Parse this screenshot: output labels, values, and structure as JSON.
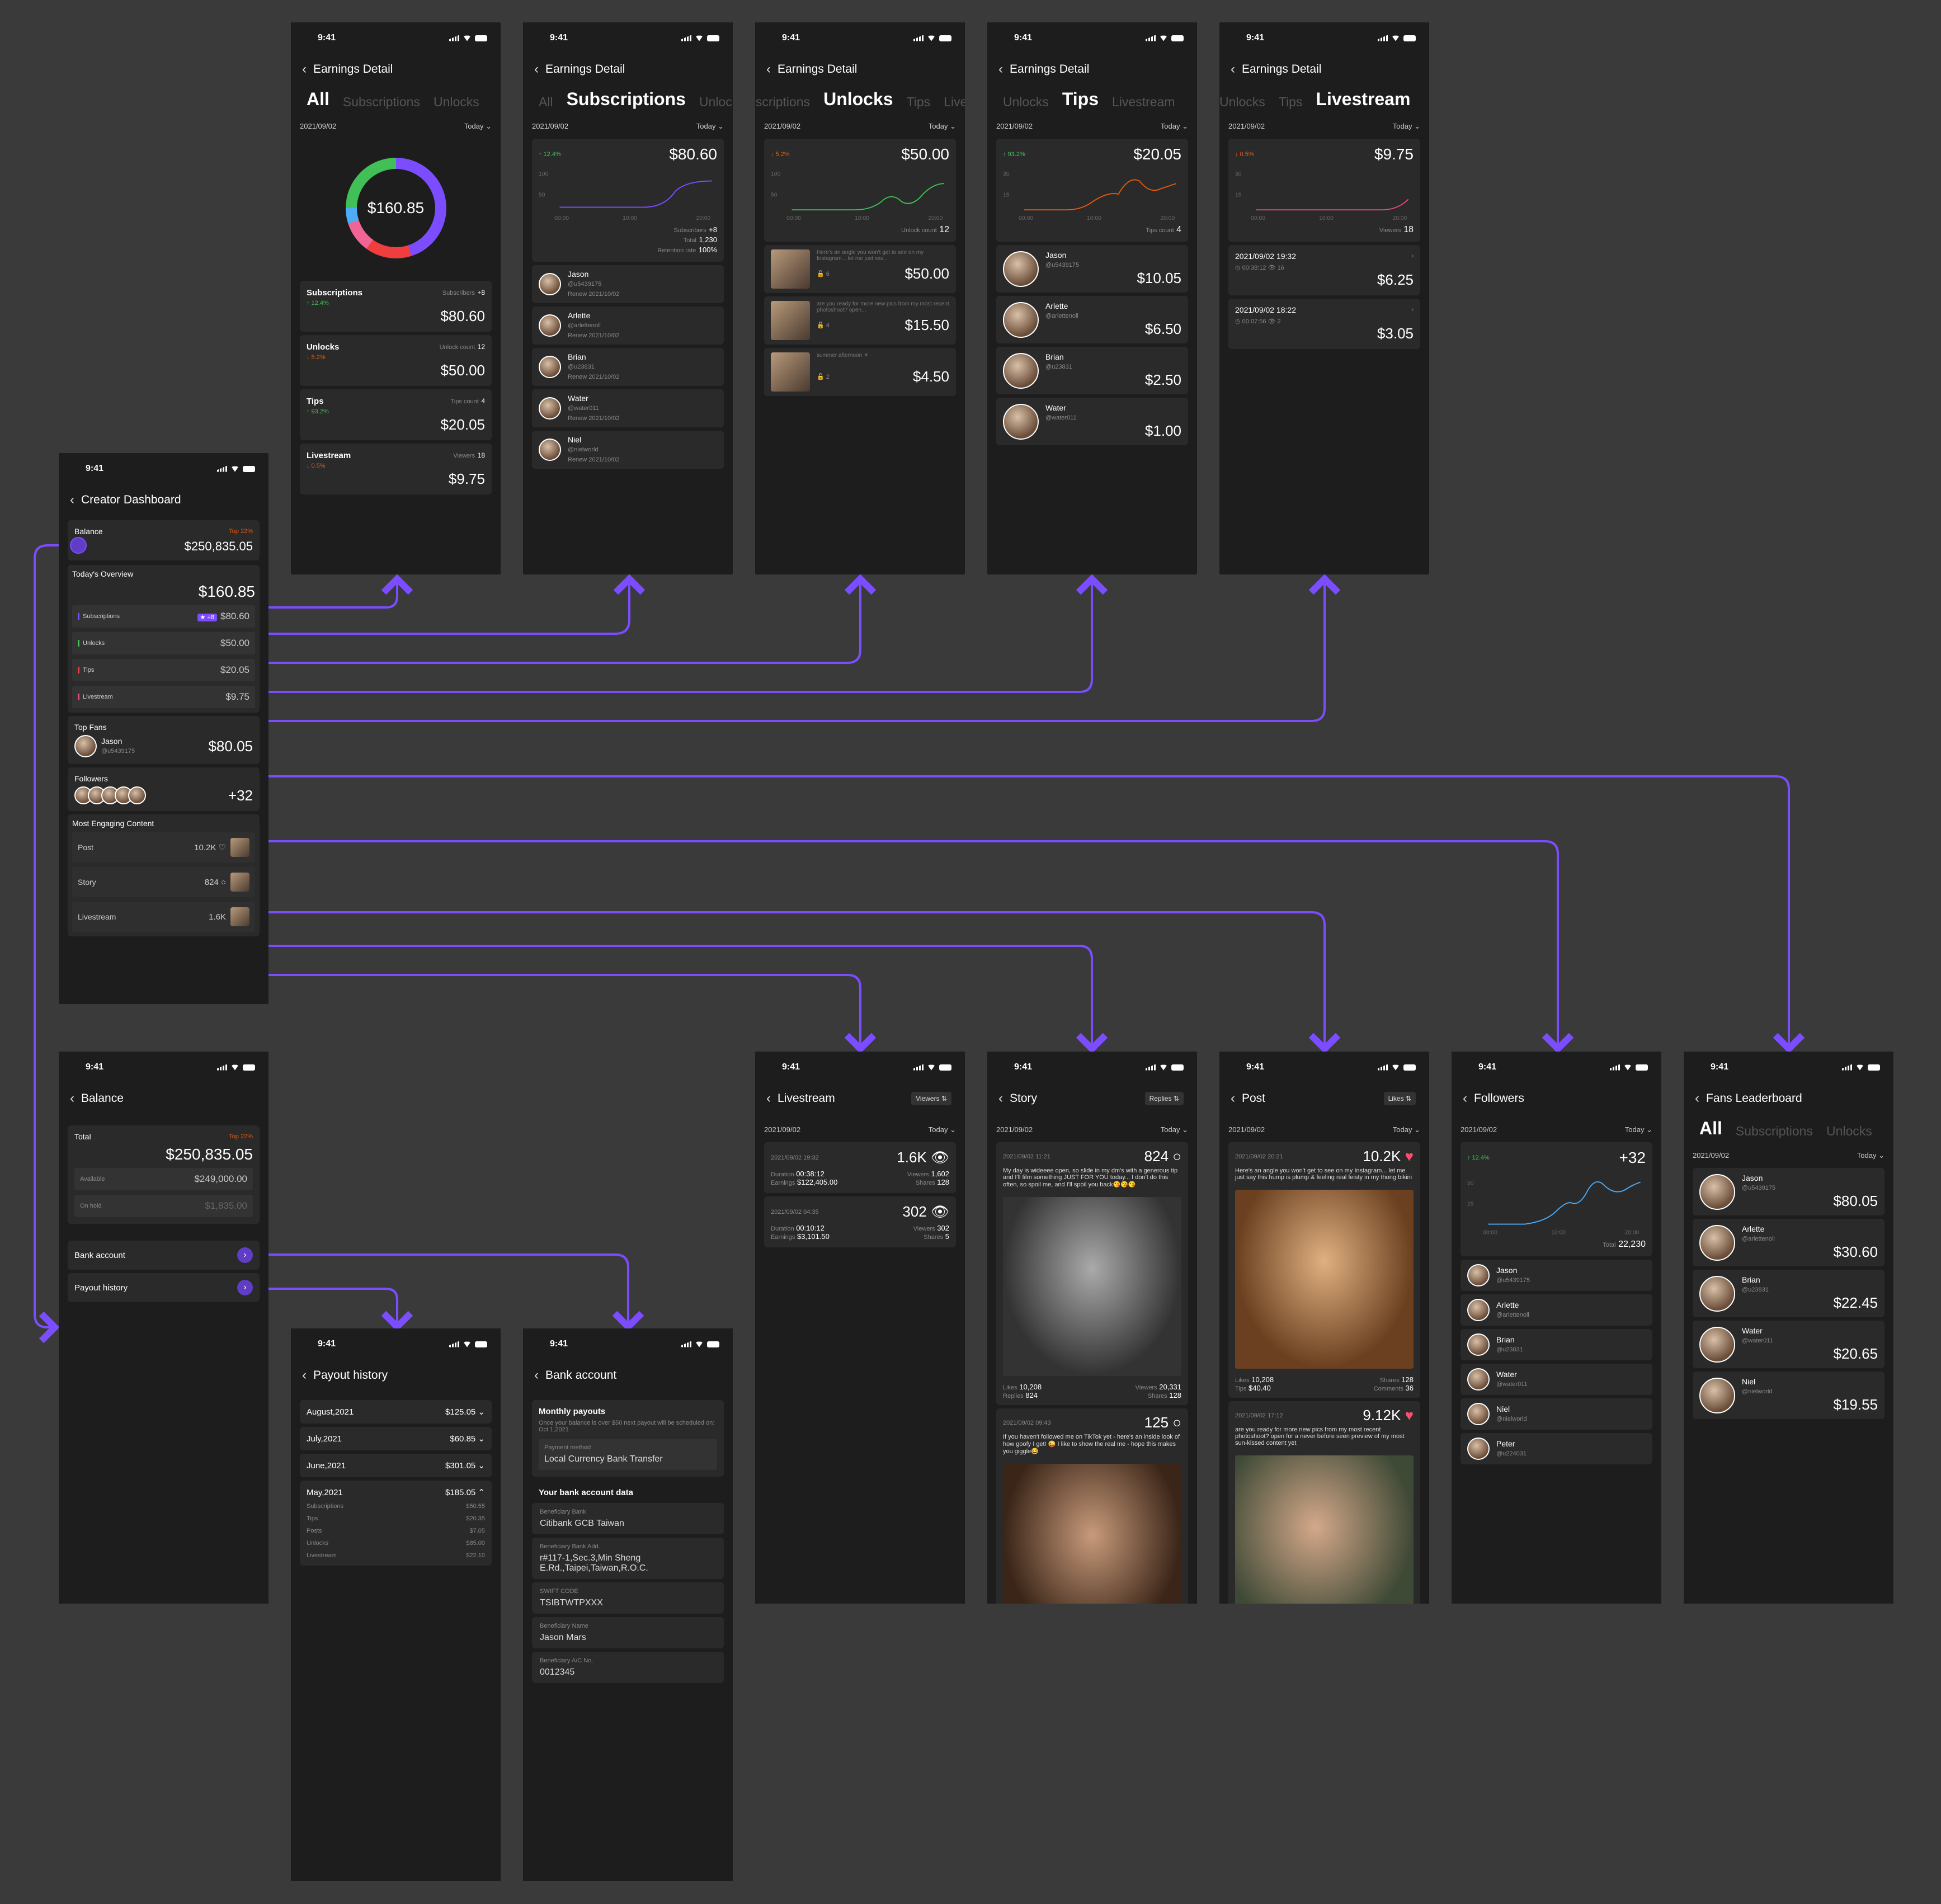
{
  "time": "9:41",
  "common": {
    "date": "2021/09/02",
    "today": "Today",
    "earnings_title": "Earnings Detail"
  },
  "tabs": {
    "all": "All",
    "subscriptions": "Subscriptions",
    "unlocks": "Unlocks",
    "tips": "Tips",
    "livestream": "Livestream"
  },
  "colors": {
    "accent": "#7b4dff",
    "up": "#40c057",
    "down": "#e8590c",
    "heart": "#ff4d6a"
  },
  "all": {
    "total": "$160.85",
    "items": [
      {
        "label": "Subscriptions",
        "meta": "Subscribers",
        "meta_val": "+8",
        "change": "↑ 12.4%",
        "dir": "up",
        "amount": "$80.60"
      },
      {
        "label": "Unlocks",
        "meta": "Unlock count",
        "meta_val": "12",
        "change": "↓ 5.2%",
        "dir": "down",
        "amount": "$50.00"
      },
      {
        "label": "Tips",
        "meta": "Tips count",
        "meta_val": "4",
        "change": "↑ 93.2%",
        "dir": "up",
        "amount": "$20.05"
      },
      {
        "label": "Livestream",
        "meta": "Viewers",
        "meta_val": "18",
        "change": "↓ 0.5%",
        "dir": "down",
        "amount": "$9.75"
      }
    ]
  },
  "subs": {
    "change": "↑ 12.4%",
    "amount": "$80.60",
    "y_top": "100",
    "y_mid": "50",
    "x": [
      "00:00",
      "10:00",
      "20:00"
    ],
    "stats": [
      {
        "k": "Subscribers",
        "v": "+8"
      },
      {
        "k": "Total",
        "v": "1,230"
      },
      {
        "k": "Retention rate",
        "v": "100%"
      }
    ],
    "people": [
      {
        "name": "Jason",
        "handle": "@u5439175",
        "renew": "Renew 2021/10/02"
      },
      {
        "name": "Arlette",
        "handle": "@arlettenoll",
        "renew": "Renew 2021/10/02"
      },
      {
        "name": "Brian",
        "handle": "@u23831",
        "renew": "Renew 2021/10/02"
      },
      {
        "name": "Water",
        "handle": "@water011",
        "renew": "Renew 2021/10/02"
      },
      {
        "name": "Niel",
        "handle": "@nielworld",
        "renew": "Renew 2021/10/02"
      }
    ]
  },
  "unlocks": {
    "change": "↓ 5.2%",
    "amount": "$50.00",
    "y_top": "100",
    "y_mid": "50",
    "x": [
      "00:00",
      "10:00",
      "20:00"
    ],
    "count_label": "Unlock count",
    "count": "12",
    "posts": [
      {
        "text": "Here's an angle you won't get to see on my Instagram... let me just sav...",
        "count": "6",
        "amount": "$50.00"
      },
      {
        "text": "are you ready for more new pics from my most recent photoshoot? open...",
        "count": "4",
        "amount": "$15.50"
      },
      {
        "text": "summer afternoon ☀",
        "count": "2",
        "amount": "$4.50"
      }
    ]
  },
  "tips": {
    "change": "↑ 93.2%",
    "amount": "$20.05",
    "y_top": "35",
    "y_mid": "15",
    "x": [
      "00:00",
      "10:00",
      "20:00"
    ],
    "count_label": "Tips count",
    "count": "4",
    "people": [
      {
        "name": "Jason",
        "handle": "@u5439175",
        "amount": "$10.05"
      },
      {
        "name": "Arlette",
        "handle": "@arlettenoll",
        "amount": "$6.50"
      },
      {
        "name": "Brian",
        "handle": "@u23831",
        "amount": "$2.50"
      },
      {
        "name": "Water",
        "handle": "@water011",
        "amount": "$1.00"
      }
    ]
  },
  "live": {
    "change": "↓ 0.5%",
    "amount": "$9.75",
    "y_top": "30",
    "y_mid": "15",
    "x": [
      "00:00",
      "10:00",
      "20:00"
    ],
    "count_label": "Viewers",
    "count": "18",
    "sessions": [
      {
        "date": "2021/09/02 19:32",
        "duration": "00:38:12",
        "viewers": "16",
        "amount": "$6.25"
      },
      {
        "date": "2021/09/02 18:22",
        "duration": "00:07:56",
        "viewers": "2",
        "amount": "$3.05"
      }
    ]
  },
  "dash": {
    "title": "Creator Dashboard",
    "balance_label": "Balance",
    "balance_badge": "Top 22%",
    "balance": "$250,835.05",
    "overview_label": "Today's Overview",
    "overview_total": "$160.85",
    "overview": [
      {
        "label": "Subscriptions",
        "amount": "$80.60",
        "badge": "★ +8",
        "color": "#7b4dff"
      },
      {
        "label": "Unlocks",
        "amount": "$50.00",
        "badge": "",
        "color": "#40c057"
      },
      {
        "label": "Tips",
        "amount": "$20.05",
        "badge": "",
        "color": "#f03e3e"
      },
      {
        "label": "Livestream",
        "amount": "$9.75",
        "badge": "",
        "color": "#e64980"
      }
    ],
    "topfans_label": "Top Fans",
    "topfan_name": "Jason",
    "topfan_handle": "@u5439175",
    "topfan_amount": "$80.05",
    "followers_label": "Followers",
    "followers_count": "+32",
    "engaging_label": "Most Engaging Content",
    "engaging": [
      {
        "label": "Post",
        "value": "10.2K ♡"
      },
      {
        "label": "Story",
        "value": "824 ○"
      },
      {
        "label": "Livestream",
        "value": "1.6K"
      }
    ]
  },
  "balance": {
    "title": "Balance",
    "total_label": "Total",
    "badge": "Top 22%",
    "total": "$250,835.05",
    "available_label": "Available",
    "available": "$249,000.00",
    "onhold_label": "On hold",
    "onhold": "$1,835.00",
    "bank_label": "Bank account",
    "payout_label": "Payout history"
  },
  "payout": {
    "title": "Payout history",
    "months": [
      {
        "month": "August,2021",
        "amount": "$125.05 ⌄"
      },
      {
        "month": "July,2021",
        "amount": "$60.85 ⌄"
      },
      {
        "month": "June,2021",
        "amount": "$301.05 ⌄"
      }
    ],
    "open_month": "May,2021",
    "open_amount": "$185.05 ⌃",
    "breakdown": [
      {
        "k": "Subscriptions",
        "v": "$50.55"
      },
      {
        "k": "Tips",
        "v": "$20.35"
      },
      {
        "k": "Posts",
        "v": "$7.05"
      },
      {
        "k": "Unlocks",
        "v": "$85.00"
      },
      {
        "k": "Livestream",
        "v": "$22.10"
      }
    ]
  },
  "bank": {
    "title": "Bank account",
    "monthly_label": "Monthly payouts",
    "monthly_desc": "Once your balance is over $50 next payout will be scheduled on: Oct 1,2021",
    "method_label": "Payment method",
    "method": "Local Currency Bank Transfer",
    "data_label": "Your bank account data",
    "fields": [
      {
        "k": "Beneficiary Bank",
        "v": "Citibank GCB Taiwan"
      },
      {
        "k": "Beneficiary Bank Add.",
        "v": "r#117-1,Sec.3,Min Sheng E.Rd.,Taipei,Taiwan,R.O.C."
      },
      {
        "k": "SWIFT CODE",
        "v": "TSIBTWTPXXX"
      },
      {
        "k": "Beneficiary Name",
        "v": "Jason Mars"
      },
      {
        "k": "Beneficiary A/C No.",
        "v": "0012345"
      }
    ]
  },
  "livestream_detail": {
    "title": "Livestream",
    "sort": "Viewers ⇅",
    "items": [
      {
        "date": "2021/09/02 19:32",
        "count": "1.6K",
        "duration": "00:38:12",
        "earnings": "$122,405.00",
        "viewers": "1,602",
        "shares": "128"
      },
      {
        "date": "2021/09/02 04:35",
        "count": "302",
        "duration": "00:10:12",
        "earnings": "$3,101.50",
        "viewers": "302",
        "shares": "5"
      }
    ],
    "lbl_duration": "Duration",
    "lbl_earnings": "Earnings",
    "lbl_viewers": "Viewers",
    "lbl_shares": "Shares"
  },
  "story": {
    "title": "Story",
    "sort": "Replies ⇅",
    "items": [
      {
        "date": "2021/09/02 11:21",
        "count": "824",
        "text": "My day is wideeee open, so slide in my dm's with a generous tip and I'll film something JUST FOR YOU today... I don't do this often, so spoil me, and I'll spoil you back😘😘😘",
        "likes": "10,208",
        "replies": "824",
        "viewers": "20,331",
        "shares": "128"
      },
      {
        "date": "2021/09/02 09:43",
        "count": "125",
        "text": "If you haven't followed me on TikTok yet - here's an inside look of how goofy I get! 😜 I like to show the real me - hope this makes you giggle😂"
      }
    ],
    "lbl_likes": "Likes",
    "lbl_replies": "Replies",
    "lbl_viewers": "Viewers",
    "lbl_shares": "Shares"
  },
  "post": {
    "title": "Post",
    "sort": "Likes ⇅",
    "items": [
      {
        "date": "2021/09/02 20:21",
        "count": "10.2K",
        "text": "Here's an angle you won't get to see on my Instagram... let me just say this hump is plump & feeling real feisty in my thong bikini",
        "likes": "10,208",
        "tips": "$40.40",
        "shares": "128",
        "comments": "36"
      },
      {
        "date": "2021/09/02 17:12",
        "count": "9.12K",
        "text": "are you ready for more new pics from my most recent photoshoot? open for a never before seen preview of my most sun-kissed content yet"
      }
    ],
    "lbl_likes": "Likes",
    "lbl_tips": "Tips",
    "lbl_shares": "Shares",
    "lbl_comments": "Comments"
  },
  "followers": {
    "title": "Followers",
    "change": "↑ 12.4%",
    "count": "+32",
    "y_top": "50",
    "y_mid": "25",
    "x": [
      "00:00",
      "10:00",
      "20:00"
    ],
    "total_label": "Total",
    "total": "22,230",
    "people": [
      {
        "name": "Jason",
        "handle": "@u5439175"
      },
      {
        "name": "Arlette",
        "handle": "@arlettenoll"
      },
      {
        "name": "Brian",
        "handle": "@u23831"
      },
      {
        "name": "Water",
        "handle": "@water011"
      },
      {
        "name": "Niel",
        "handle": "@nielworld"
      },
      {
        "name": "Peter",
        "handle": "@u224031"
      }
    ]
  },
  "leader": {
    "title": "Fans Leaderboard",
    "people": [
      {
        "name": "Jason",
        "handle": "@u5439175",
        "amount": "$80.05"
      },
      {
        "name": "Arlette",
        "handle": "@arlettenoll",
        "amount": "$30.60"
      },
      {
        "name": "Brian",
        "handle": "@u23831",
        "amount": "$22.45"
      },
      {
        "name": "Water",
        "handle": "@water011",
        "amount": "$20.65"
      },
      {
        "name": "Niel",
        "handle": "@nielworld",
        "amount": "$19.55"
      }
    ]
  }
}
